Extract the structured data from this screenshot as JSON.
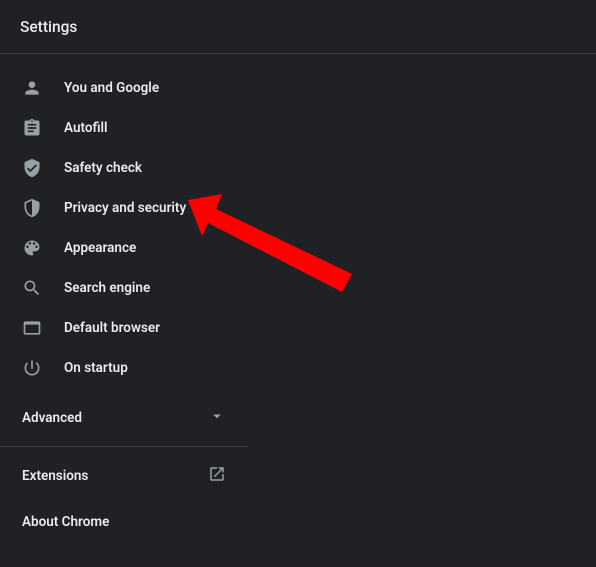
{
  "header": {
    "title": "Settings"
  },
  "sidebar": {
    "items": [
      {
        "label": "You and Google"
      },
      {
        "label": "Autofill"
      },
      {
        "label": "Safety check"
      },
      {
        "label": "Privacy and security"
      },
      {
        "label": "Appearance"
      },
      {
        "label": "Search engine"
      },
      {
        "label": "Default browser"
      },
      {
        "label": "On startup"
      }
    ],
    "advanced_label": "Advanced",
    "extensions_label": "Extensions",
    "about_label": "About Chrome"
  }
}
